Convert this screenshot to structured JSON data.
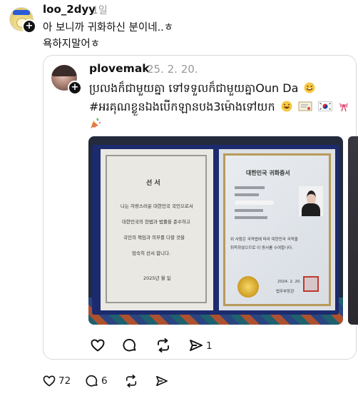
{
  "comment": {
    "username": "loo_2dyy",
    "time": "1일",
    "lines": [
      "아 보니까 귀화하신 분이네..ㅎ",
      "욕하지말어ㅎ"
    ]
  },
  "quoted_post": {
    "username": "plovemak",
    "date": "25. 2. 20.",
    "lines": [
      "ប្រលងក៏ជាមួយគ្នា ទៅទទួលក៏ជាមួយគ្នាOun Da",
      "#អរគុណខ្លួនឯងបើកឡានបង3ម៉ោងទៅយក"
    ],
    "emojis": [
      "grinning-sweat-emoji",
      "laughing-emoji",
      "certificate-emoji",
      "korea-flag-emoji",
      "ribbon-emoji",
      "party-emoji"
    ],
    "actions": {
      "repost_count": "1"
    },
    "photo": {
      "left_page": {
        "title": "선  서",
        "lines": [
          "나는 자랑스러운 대한민국 국민으로서",
          "대한민국의 헌법과 법률을 준수하고",
          "국민의 책임과 의무를 다할 것을",
          "엄숙히 선서 합니다."
        ],
        "date": "2025년    월    일"
      },
      "right_page": {
        "title": "대한민국 귀화증서",
        "body": [
          "위 사람은 국적법에 따라 대한민국 국적을",
          "취득하였으므로 이 증서를 수여합니다."
        ],
        "date": "2024. 2. 20.",
        "issuer": "법무부장관"
      }
    }
  },
  "footer": {
    "like_count": "72",
    "comment_count": "6"
  },
  "colors": {
    "text": "#111111",
    "muted": "#999999",
    "border": "#d9d9d9"
  }
}
